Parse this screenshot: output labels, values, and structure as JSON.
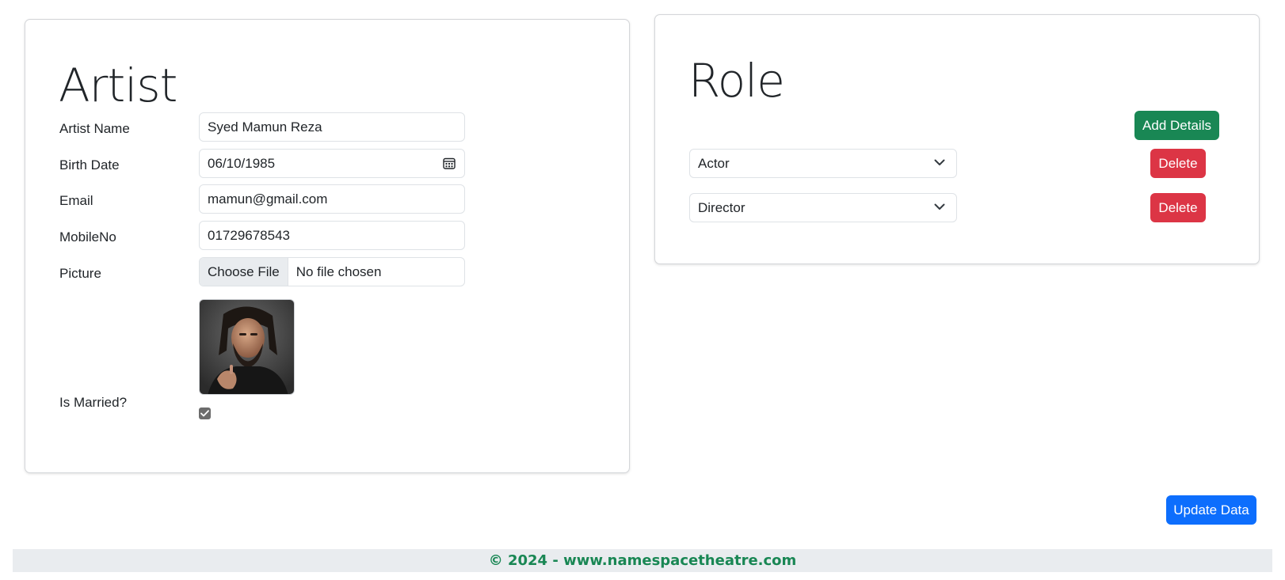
{
  "artist": {
    "title": "Artist",
    "fields": {
      "artist_name": {
        "label": "Artist Name",
        "value": "Syed Mamun Reza"
      },
      "birth_date": {
        "label": "Birth Date",
        "value": "06/10/1985"
      },
      "email": {
        "label": "Email",
        "value": "mamun@gmail.com"
      },
      "mobile": {
        "label": "MobileNo",
        "value": "01729678543"
      },
      "picture": {
        "label": "Picture",
        "button": "Choose File",
        "status": "No file chosen"
      },
      "married": {
        "label": "Is Married?",
        "checked": true
      }
    }
  },
  "role": {
    "title": "Role",
    "add_button": "Add Details",
    "items": [
      {
        "value": "Actor",
        "delete_label": "Delete"
      },
      {
        "value": "Director",
        "delete_label": "Delete"
      }
    ]
  },
  "actions": {
    "update_button": "Update Data"
  },
  "footer": {
    "text": "© 2024 - www.namespacetheatre.com"
  },
  "colors": {
    "success": "#198754",
    "danger": "#dc3545",
    "primary": "#0d6efd",
    "footer_bg": "#e9ecef"
  },
  "icons": {
    "date_picker": "calendar-icon",
    "select_toggle": "chevron-down-icon",
    "married_check": "checkmark-icon"
  }
}
